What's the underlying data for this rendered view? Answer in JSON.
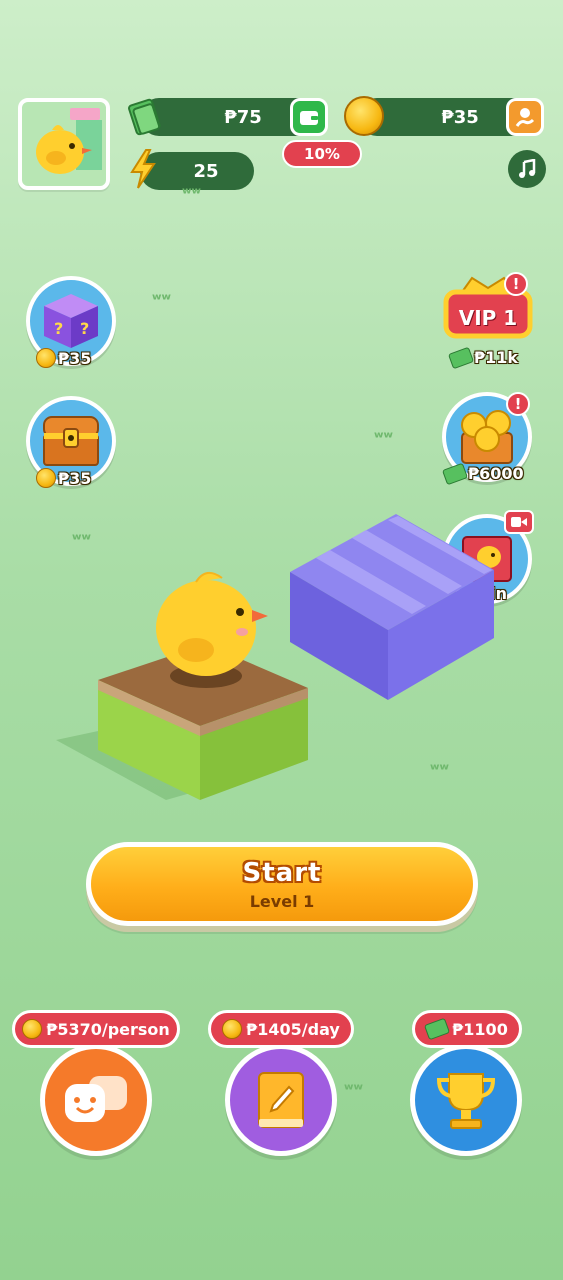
{
  "header": {
    "cash_amount": "₱75",
    "coin_amount": "₱35",
    "energy": "25",
    "wallet_percent": "10%"
  },
  "left_rewards": [
    {
      "price": "₱35"
    },
    {
      "price": "₱35"
    }
  ],
  "right_rewards": [
    {
      "price": "₱11k",
      "badge": "VIP 1"
    },
    {
      "price": "₱6000"
    },
    {
      "label": "Skin"
    }
  ],
  "start": {
    "label": "Start",
    "level": "Level 1"
  },
  "bottom": [
    {
      "tag": "₱5370/person",
      "icon": "chat-faces-icon"
    },
    {
      "tag": "₱1405/day",
      "icon": "notebook-icon"
    },
    {
      "tag": "₱1100",
      "icon": "trophy-icon"
    }
  ],
  "colors": {
    "pill_dark_green": "#2f6b3a",
    "alert_red": "#e2414f",
    "start_orange": "#ffae1a",
    "bottom_orange": "#f57a2a",
    "bottom_purple": "#a05de0",
    "bottom_blue": "#2f8fe0"
  }
}
